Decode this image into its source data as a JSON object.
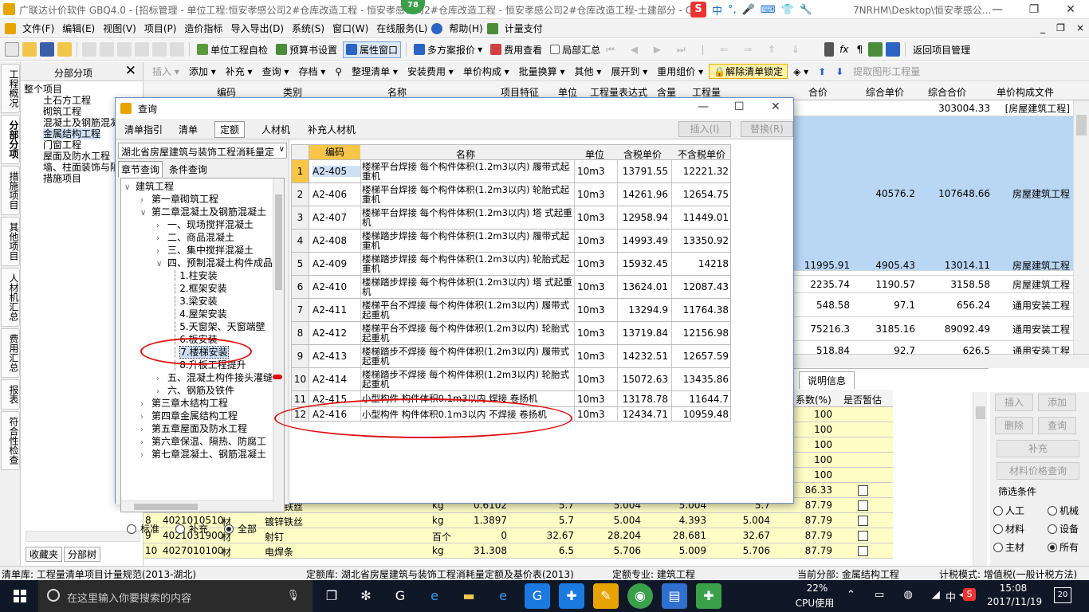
{
  "window": {
    "title": "广联达计价软件 GBQ4.0 - [招标管理 - 单位工程:恒安孝感公司2#仓库改造工程 - 恒安孝感公司2#仓库改造工程 - 恒安孝感公司2#仓库改造工程-土建部分 - C:\\U",
    "title_tail": "7NRHM\\Desktop\\恒安孝感公...",
    "badge": "78",
    "ime_labels": [
      "中",
      "°,",
      "S"
    ],
    "min": "—",
    "restore": "❐",
    "close": "✕"
  },
  "menu": [
    "文件(F)",
    "编辑(E)",
    "视图(V)",
    "项目(P)",
    "造价指标",
    "导入导出(D)",
    "系统(S)",
    "窗口(W)",
    "在线服务(L)",
    "帮助(H)",
    "计量支付"
  ],
  "mdi_buttons": [
    "_",
    "❐",
    "×"
  ],
  "toolbar1": [
    "单位工程自检",
    "预算书设置",
    "属性窗口",
    "多方案报价",
    "费用查看",
    "局部汇总",
    "返回项目管理"
  ],
  "left_tabs": [
    "工程概况",
    "分部分项",
    "措施项目",
    "其他项目",
    "人材机汇总",
    "费用汇总",
    "报表",
    "符合性检查"
  ],
  "nav": {
    "header": "分部分项",
    "close": "✕",
    "items": [
      "整个项目",
      "土石方工程",
      "砌筑工程",
      "混凝土及钢筋混凝",
      "金属结构工程",
      "门窗工程",
      "屋面及防水工程",
      "墙、柱面装饰与隔",
      "措施项目"
    ],
    "bottom_tabs": [
      "收藏夹",
      "分部树"
    ]
  },
  "toolbar2": [
    "插入",
    "添加",
    "补充",
    "查询",
    "存档",
    "整理清单",
    "安装费用",
    "单价构成",
    "批量换算",
    "其他",
    "展开到",
    "重用组价",
    "解除清单锁定",
    "提取图形工程量"
  ],
  "grid_headers": [
    "编码",
    "类别",
    "名称",
    "项目特征",
    "单位",
    "工程量表达式",
    "含量",
    "工程量",
    "合价",
    "综合单价",
    "综合合价",
    "单价构成文件"
  ],
  "grid_rows": [
    {
      "heji": "",
      "zhdj": "",
      "zhhj": "303004.33",
      "file": "[房屋建筑工程]"
    },
    {
      "heji": "",
      "zhdj": "40576.2",
      "zhhj": "107648.66",
      "file": "房屋建筑工程"
    },
    {
      "heji": "11995.91",
      "zhdj": "4905.43",
      "zhhj": "13014.11",
      "file": "房屋建筑工程"
    },
    {
      "heji": "2235.74",
      "zhdj": "1190.57",
      "zhhj": "3158.58",
      "file": "房屋建筑工程"
    },
    {
      "heji": "548.58",
      "zhdj": "97.1",
      "zhhj": "656.24",
      "file": "通用安装工程"
    },
    {
      "heji": "75216.3",
      "zhdj": "3185.16",
      "zhhj": "89092.49",
      "file": "通用安装工程"
    },
    {
      "heji": "518.84",
      "zhdj": "92.7",
      "zhhj": "626.5",
      "file": "通用安装工程"
    }
  ],
  "lower": {
    "tab": "说明信息",
    "headers": [
      "系数(%)",
      "是否暂估"
    ],
    "rows": [
      {
        "n": "",
        "code": "",
        "type": "",
        "name": "",
        "unit": "",
        "qty": "",
        "p1": "",
        "p2": "",
        "p3": "",
        "p4": "",
        "coef": "100",
        "chk": false
      },
      {
        "n": "",
        "code": "",
        "type": "",
        "name": "",
        "unit": "",
        "qty": "",
        "p1": "",
        "p2": "",
        "p3": "",
        "p4": "",
        "coef": "100",
        "chk": false
      },
      {
        "n": "",
        "code": "",
        "type": "",
        "name": "",
        "unit": "",
        "qty": "",
        "p1": "",
        "p2": "",
        "p3": "",
        "p4": "",
        "coef": "100",
        "chk": false
      },
      {
        "n": "",
        "code": "",
        "type": "",
        "name": "",
        "unit": "",
        "qty": "",
        "p1": "",
        "p2": "",
        "p3": "",
        "p4": "",
        "coef": "100",
        "chk": false
      },
      {
        "n": "",
        "code": "",
        "type": "",
        "name": "",
        "unit": "",
        "qty": "",
        "p1": "",
        "p2": "",
        "p3": "",
        "p4": "",
        "coef": "100",
        "chk": false
      },
      {
        "n": "",
        "code": "",
        "type": "",
        "name": "",
        "unit": "",
        "qty": "",
        "p1": "",
        "p2": "",
        "p3": "",
        "p4": "",
        "coef": "86.33",
        "chk": true
      },
      {
        "n": "7",
        "code": "4021010510",
        "type": "材",
        "name": "镀锌铁丝",
        "unit": "kg",
        "qty": "0.6102",
        "p1": "5.7",
        "p2": "5.004",
        "p3": "5.004",
        "p4": "5.7",
        "coef": "87.79",
        "chk": true
      },
      {
        "n": "8",
        "code": "4021010510",
        "type": "材",
        "name": "镀锌铁丝",
        "unit": "kg",
        "qty": "1.3897",
        "p1": "5.7",
        "p2": "5.004",
        "p3": "4.393",
        "p4": "5.004",
        "coef": "87.79",
        "chk": true
      },
      {
        "n": "9",
        "code": "4021031900",
        "type": "材",
        "name": "射钉",
        "unit": "百个",
        "qty": "0",
        "p1": "32.67",
        "p2": "28.204",
        "p3": "28.681",
        "p4": "32.67",
        "coef": "87.79",
        "chk": true
      },
      {
        "n": "10",
        "code": "4027010100",
        "type": "材",
        "name": "电焊条",
        "unit": "kg",
        "qty": "31.308",
        "p1": "6.5",
        "p2": "5.706",
        "p3": "5.009",
        "p4": "5.706",
        "coef": "87.79",
        "chk": true
      }
    ]
  },
  "right_buttons": {
    "insert": "插入",
    "add": "添加",
    "delete": "删除",
    "query": "查询",
    "supplement": "补充",
    "material_query": "材料价格查询",
    "filter_title": "筛选条件",
    "radios": [
      "人工",
      "机械",
      "材料",
      "设备",
      "主材",
      "所有"
    ]
  },
  "status": {
    "qingdan": "清单库: 工程量清单项目计量规范(2013-湖北)",
    "dinge": "定额库: 湖北省房屋建筑与装饰工程消耗量定额及基价表(2013)",
    "zhuanye": "定额专业: 建筑工程",
    "fenbu": "当前分部: 金属结构工程",
    "jisuan": "计税模式: 增值税(一般计税方法)"
  },
  "taskbar": {
    "search": "在这里输入你要搜索的内容",
    "cpu_pct": "22%",
    "cpu_label": "CPU使用",
    "lang": "中",
    "time": "15:08",
    "date": "2017/11/19",
    "notif": "20"
  },
  "dialog": {
    "title": "查询",
    "min": "—",
    "max": "☐",
    "close": "✕",
    "tabs": [
      "清单指引",
      "清单",
      "定额",
      "人材机",
      "补充人材机"
    ],
    "btn_insert": "插入(I)",
    "btn_replace": "替换(R)",
    "library": "湖北省房屋建筑与装饰工程消耗量定",
    "subtabs": [
      "章节查询",
      "条件查询"
    ],
    "tree": [
      {
        "t": "建筑工程",
        "lvl": 0,
        "ar": "v"
      },
      {
        "t": "第一章砌筑工程",
        "lvl": 1,
        "ar": ">"
      },
      {
        "t": "第二章混凝土及钢筋混凝土",
        "lvl": 1,
        "ar": "v"
      },
      {
        "t": "一、现场搅拌混凝土",
        "lvl": 2,
        "ar": ">"
      },
      {
        "t": "二、商品混凝土",
        "lvl": 2,
        "ar": ">"
      },
      {
        "t": "三、集中搅拌混凝土",
        "lvl": 2,
        "ar": ">"
      },
      {
        "t": "四、预制混凝土构件成品",
        "lvl": 2,
        "ar": "v"
      },
      {
        "t": "1.柱安装",
        "lvl": 3,
        "ar": ""
      },
      {
        "t": "2.框架安装",
        "lvl": 3,
        "ar": ""
      },
      {
        "t": "3.梁安装",
        "lvl": 3,
        "ar": ""
      },
      {
        "t": "4.屋架安装",
        "lvl": 3,
        "ar": ""
      },
      {
        "t": "5.天窗架、天窗端壁",
        "lvl": 3,
        "ar": ""
      },
      {
        "t": "6.板安装",
        "lvl": 3,
        "ar": ""
      },
      {
        "t": "7.楼梯安装",
        "lvl": 3,
        "ar": "",
        "sel": true
      },
      {
        "t": "8.升板工程提升",
        "lvl": 3,
        "ar": ""
      },
      {
        "t": "五、混凝土构件接头灌缝",
        "lvl": 2,
        "ar": ">"
      },
      {
        "t": "六、钢筋及铁件",
        "lvl": 2,
        "ar": ">"
      },
      {
        "t": "第三章木结构工程",
        "lvl": 1,
        "ar": ">"
      },
      {
        "t": "第四章金属结构工程",
        "lvl": 1,
        "ar": ">"
      },
      {
        "t": "第五章屋面及防水工程",
        "lvl": 1,
        "ar": ">"
      },
      {
        "t": "第六章保温、隔热、防腐工",
        "lvl": 1,
        "ar": ">"
      },
      {
        "t": "第七章混凝土、钢筋混凝土",
        "lvl": 1,
        "ar": ">"
      }
    ],
    "radios": [
      "标准",
      "补充",
      "全部"
    ],
    "radio_selected": "全部",
    "grid_headers": [
      "编码",
      "名称",
      "单位",
      "含税单价",
      "不含税单价"
    ],
    "rows": [
      {
        "n": "1",
        "code": "A2-405",
        "name": "楼梯平台焊接 每个构件体积(1.2m3以内) 履带式起重机",
        "unit": "10m3",
        "p1": "13791.55",
        "p2": "12221.32"
      },
      {
        "n": "2",
        "code": "A2-406",
        "name": "楼梯平台焊接 每个构件体积(1.2m3以内) 轮胎式起重机",
        "unit": "10m3",
        "p1": "14261.96",
        "p2": "12654.75"
      },
      {
        "n": "3",
        "code": "A2-407",
        "name": "楼梯平台焊接 每个构件体积(1.2m3以内) 塔 式起重机",
        "unit": "10m3",
        "p1": "12958.94",
        "p2": "11449.01"
      },
      {
        "n": "4",
        "code": "A2-408",
        "name": "楼梯踏步焊接 每个构件体积(1.2m3以内) 履带式起重机",
        "unit": "10m3",
        "p1": "14993.49",
        "p2": "13350.92"
      },
      {
        "n": "5",
        "code": "A2-409",
        "name": "楼梯踏步焊接 每个构件体积(1.2m3以内) 轮胎式起重机",
        "unit": "10m3",
        "p1": "15932.45",
        "p2": "14218"
      },
      {
        "n": "6",
        "code": "A2-410",
        "name": "楼梯踏步焊接 每个构件体积(1.2m3以内) 塔 式起重机",
        "unit": "10m3",
        "p1": "13624.01",
        "p2": "12087.43"
      },
      {
        "n": "7",
        "code": "A2-411",
        "name": "楼梯平台不焊接 每个构件体积(1.2m3以内) 履带式起重机",
        "unit": "10m3",
        "p1": "13294.9",
        "p2": "11764.38"
      },
      {
        "n": "8",
        "code": "A2-412",
        "name": "楼梯平台不焊接 每个构件体积(1.2m3以内) 轮胎式起重机",
        "unit": "10m3",
        "p1": "13719.84",
        "p2": "12156.98"
      },
      {
        "n": "9",
        "code": "A2-413",
        "name": "楼梯踏步不焊接 每个构件体积(1.2m3以内) 履带式起重机",
        "unit": "10m3",
        "p1": "14232.51",
        "p2": "12657.59"
      },
      {
        "n": "10",
        "code": "A2-414",
        "name": "楼梯踏步不焊接 每个构件体积(1.2m3以内) 轮胎式起重机",
        "unit": "10m3",
        "p1": "15072.63",
        "p2": "13435.86"
      },
      {
        "n": "11",
        "code": "A2-415",
        "name": "小型构件 构件体积0.1m3以内 焊接 卷扬机",
        "unit": "10m3",
        "p1": "13178.78",
        "p2": "11644.7"
      },
      {
        "n": "12",
        "code": "A2-416",
        "name": "小型构件 构件体积0.1m3以内 不焊接 卷扬机",
        "unit": "10m3",
        "p1": "12434.71",
        "p2": "10959.48"
      }
    ]
  },
  "colors": {
    "accent": "#2b64c4",
    "highlight_row": "#b9d7f5",
    "yellow": "#fefdc6",
    "annotation": "#e01010"
  }
}
